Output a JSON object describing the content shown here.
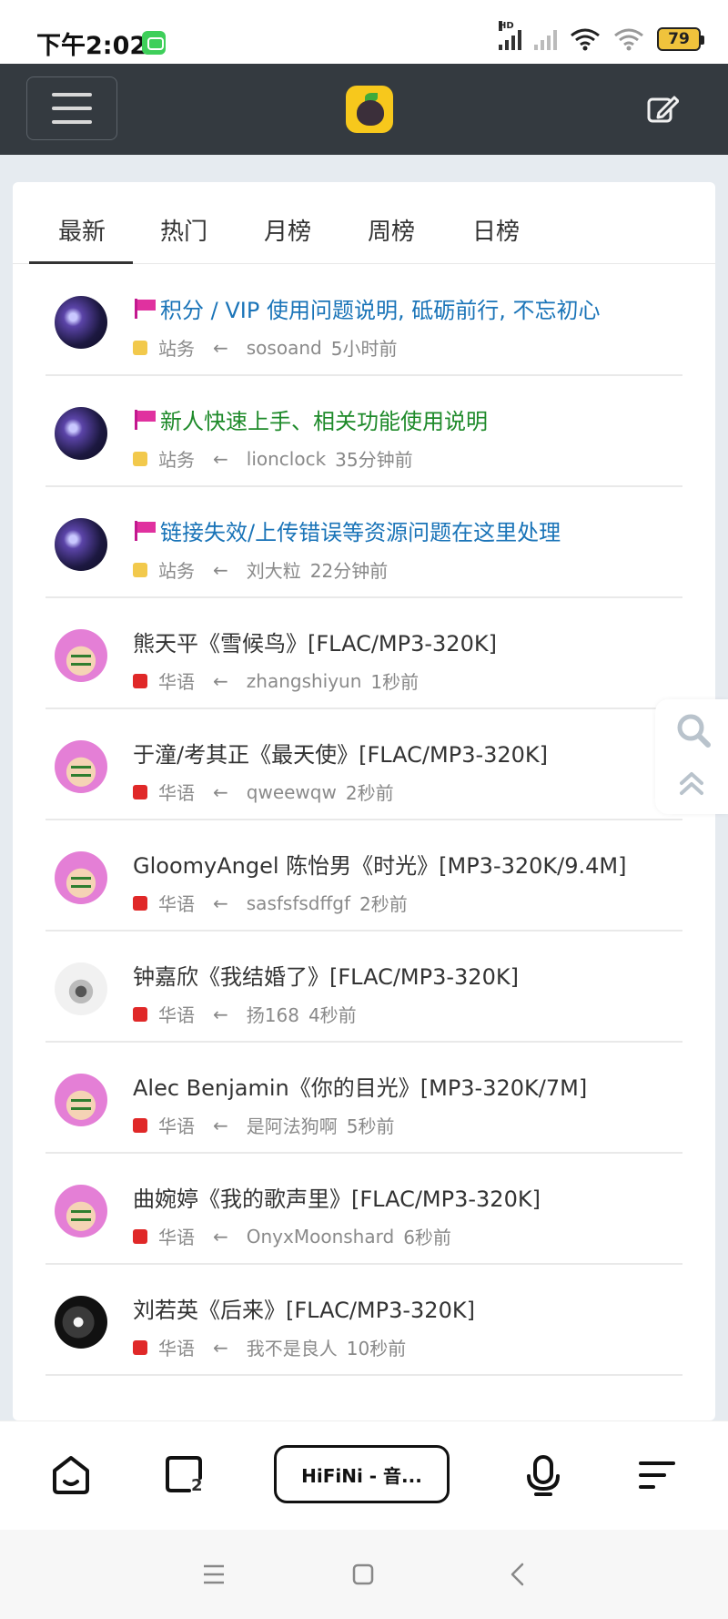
{
  "status_bar": {
    "time": "下午2:02",
    "signal_label": "HD",
    "battery": "79"
  },
  "navbar": {
    "menu_icon": "hamburger-icon",
    "logo_icon": "hifini-logo",
    "edit_icon": "edit-icon"
  },
  "tabs": [
    {
      "label": "最新",
      "active": true
    },
    {
      "label": "热门",
      "active": false
    },
    {
      "label": "月榜",
      "active": false
    },
    {
      "label": "周榜",
      "active": false
    },
    {
      "label": "日榜",
      "active": false
    }
  ],
  "threads": [
    {
      "pinned": true,
      "title": "积分 / VIP 使用问题说明, 砥砺前行, 不忘初心",
      "title_color": "blue",
      "forum": "站务",
      "forum_color": "#f2c94c",
      "arrow": "←",
      "user": "sosoand",
      "time": "5小时前",
      "avatar": "dark"
    },
    {
      "pinned": true,
      "title": "新人快速上手、相关功能使用说明",
      "title_color": "green",
      "forum": "站务",
      "forum_color": "#f2c94c",
      "arrow": "←",
      "user": "lionclock",
      "time": "35分钟前",
      "avatar": "dark"
    },
    {
      "pinned": true,
      "title": "链接失效/上传错误等资源问题在这里处理",
      "title_color": "blue",
      "forum": "站务",
      "forum_color": "#f2c94c",
      "arrow": "←",
      "user": "刘大粒",
      "time": "22分钟前",
      "avatar": "dark"
    },
    {
      "pinned": false,
      "title": "熊天平《雪候鸟》[FLAC/MP3-320K]",
      "title_color": "dark",
      "forum": "华语",
      "forum_color": "#e02828",
      "arrow": "←",
      "user": "zhangshiyun",
      "time": "1秒前",
      "avatar": "anime"
    },
    {
      "pinned": false,
      "title": "于潼/考其正《最天使》[FLAC/MP3-320K]",
      "title_color": "dark",
      "forum": "华语",
      "forum_color": "#e02828",
      "arrow": "←",
      "user": "qweewqw",
      "time": "2秒前",
      "avatar": "anime"
    },
    {
      "pinned": false,
      "title": "GloomyAngel 陈怡男《时光》[MP3-320K/9.4M]",
      "title_color": "dark",
      "forum": "华语",
      "forum_color": "#e02828",
      "arrow": "←",
      "user": "sasfsfsdffgf",
      "time": "2秒前",
      "avatar": "anime"
    },
    {
      "pinned": false,
      "title": "钟嘉欣《我结婚了》[FLAC/MP3-320K]",
      "title_color": "dark",
      "forum": "华语",
      "forum_color": "#e02828",
      "arrow": "←",
      "user": "扬168",
      "time": "4秒前",
      "avatar": "light"
    },
    {
      "pinned": false,
      "title": "Alec Benjamin《你的目光》[MP3-320K/7M]",
      "title_color": "dark",
      "forum": "华语",
      "forum_color": "#e02828",
      "arrow": "←",
      "user": "是阿法狗啊",
      "time": "5秒前",
      "avatar": "anime"
    },
    {
      "pinned": false,
      "title": "曲婉婷《我的歌声里》[FLAC/MP3-320K]",
      "title_color": "dark",
      "forum": "华语",
      "forum_color": "#e02828",
      "arrow": "←",
      "user": "OnyxMoonshard",
      "time": "6秒前",
      "avatar": "anime"
    },
    {
      "pinned": false,
      "title": "刘若英《后来》[FLAC/MP3-320K]",
      "title_color": "dark",
      "forum": "华语",
      "forum_color": "#e02828",
      "arrow": "←",
      "user": "我不是良人",
      "time": "10秒前",
      "avatar": "dog"
    }
  ],
  "side_tools": {
    "search_icon": "search-icon",
    "top_icon": "scroll-top-icon"
  },
  "browser_bar": {
    "home_icon": "home-icon",
    "tabs_icon": "tabs-icon",
    "tabs_count": "2",
    "url_text": "HiFiNi - 音...",
    "voice_icon": "microphone-icon",
    "menu_icon": "menu-icon"
  },
  "system_nav": {
    "recents_icon": "recents-icon",
    "home_icon": "home-square-icon",
    "back_icon": "back-icon"
  }
}
